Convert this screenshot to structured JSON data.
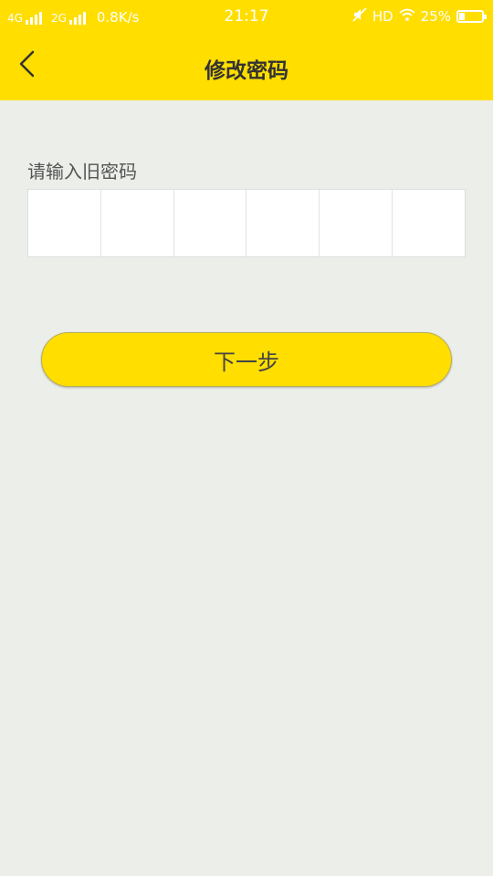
{
  "status_bar": {
    "network1": "4G",
    "network2": "2G",
    "speed": "0.8K/s",
    "time": "21:17",
    "hd": "HD",
    "battery_percent": "25%",
    "battery_level": 0.25
  },
  "header": {
    "title": "修改密码",
    "back_icon": "chevron-left-icon"
  },
  "form": {
    "label": "请输入旧密码",
    "cells": [
      "",
      "",
      "",
      "",
      "",
      ""
    ]
  },
  "next_button": {
    "label": "下一步"
  },
  "colors": {
    "accent": "#ffde00",
    "background": "#ebeee9",
    "text": "#333333"
  }
}
